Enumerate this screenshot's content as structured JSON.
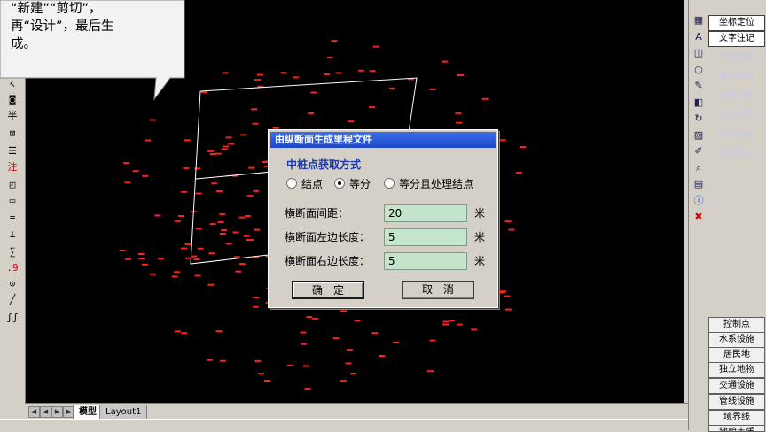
{
  "callout": {
    "lines": [
      "“新建”“剪切”，",
      "再“设计”，最后生",
      "成。"
    ]
  },
  "left_toolbar": {
    "items": [
      {
        "name": "cursor-icon",
        "glyph": "↖"
      },
      {
        "name": "camera-icon",
        "glyph": "◙"
      },
      {
        "name": "tree-icon",
        "glyph": "半"
      },
      {
        "name": "query-icon",
        "glyph": "⊠"
      },
      {
        "name": "layer-icon",
        "glyph": "☰"
      },
      {
        "name": "annotate-icon",
        "glyph": "注"
      },
      {
        "name": "rect-corner-icon",
        "glyph": "◰"
      },
      {
        "name": "rectangle-icon",
        "glyph": "▭"
      },
      {
        "name": "bars-icon",
        "glyph": "≡"
      },
      {
        "name": "comb-icon",
        "glyph": "⊥"
      },
      {
        "name": "measure-icon",
        "glyph": "∑"
      },
      {
        "name": "point-9-icon",
        "glyph": ".9"
      },
      {
        "name": "circle-point-icon",
        "glyph": "⊙"
      },
      {
        "name": "line-icon",
        "glyph": "╱"
      },
      {
        "name": "wave-icon",
        "glyph": "ʃʃ"
      }
    ]
  },
  "right_panel": {
    "top_items": [
      {
        "label": "坐标定位",
        "active": true
      },
      {
        "label": "文字注记",
        "active": true
      },
      {
        "label": "分类注记",
        "active": false
      },
      {
        "label": "通用注记",
        "active": false
      },
      {
        "label": "变换字体",
        "active": false
      },
      {
        "label": "定义字型",
        "active": false
      },
      {
        "label": "特殊注记",
        "active": false
      },
      {
        "label": "常用文字",
        "active": false
      }
    ],
    "bottom_items": [
      "控制点",
      "水系设施",
      "居民地",
      "独立地物",
      "交通设施",
      "管线设施",
      "境界线",
      "地貌土质"
    ],
    "icons": [
      "grid-icon",
      "text-a-icon",
      "layers-icon",
      "circle-icon",
      "pencil-icon",
      "cube-icon",
      "rotate-icon",
      "paint-icon",
      "pen-icon",
      "search-icon",
      "table-icon",
      "info-icon",
      "delete-icon"
    ]
  },
  "bottom_bar": {
    "tabs": [
      {
        "label": "模型",
        "active": true
      },
      {
        "label": "Layout1",
        "active": false
      }
    ]
  },
  "dialog": {
    "title": "由纵断面生成里程文件",
    "group_label": "中桩点获取方式",
    "radios": [
      {
        "label": "结点",
        "selected": false
      },
      {
        "label": "等分",
        "selected": true
      },
      {
        "label": "等分且处理结点",
        "selected": false
      }
    ],
    "fields": [
      {
        "label": "横断面间距：",
        "value": "20",
        "unit": "米"
      },
      {
        "label": "横断面左边长度：",
        "value": "5",
        "unit": "米"
      },
      {
        "label": "横断面右边长度：",
        "value": "5",
        "unit": "米"
      }
    ],
    "ok_label": "确　定",
    "cancel_label": "取　消"
  },
  "colors": {
    "canvas_bg": "#000000",
    "point_marker": "#ff2020",
    "drawn_line": "#ffffff",
    "title_bar": "#2a5ad8",
    "input_bg": "#c4e4cc"
  }
}
